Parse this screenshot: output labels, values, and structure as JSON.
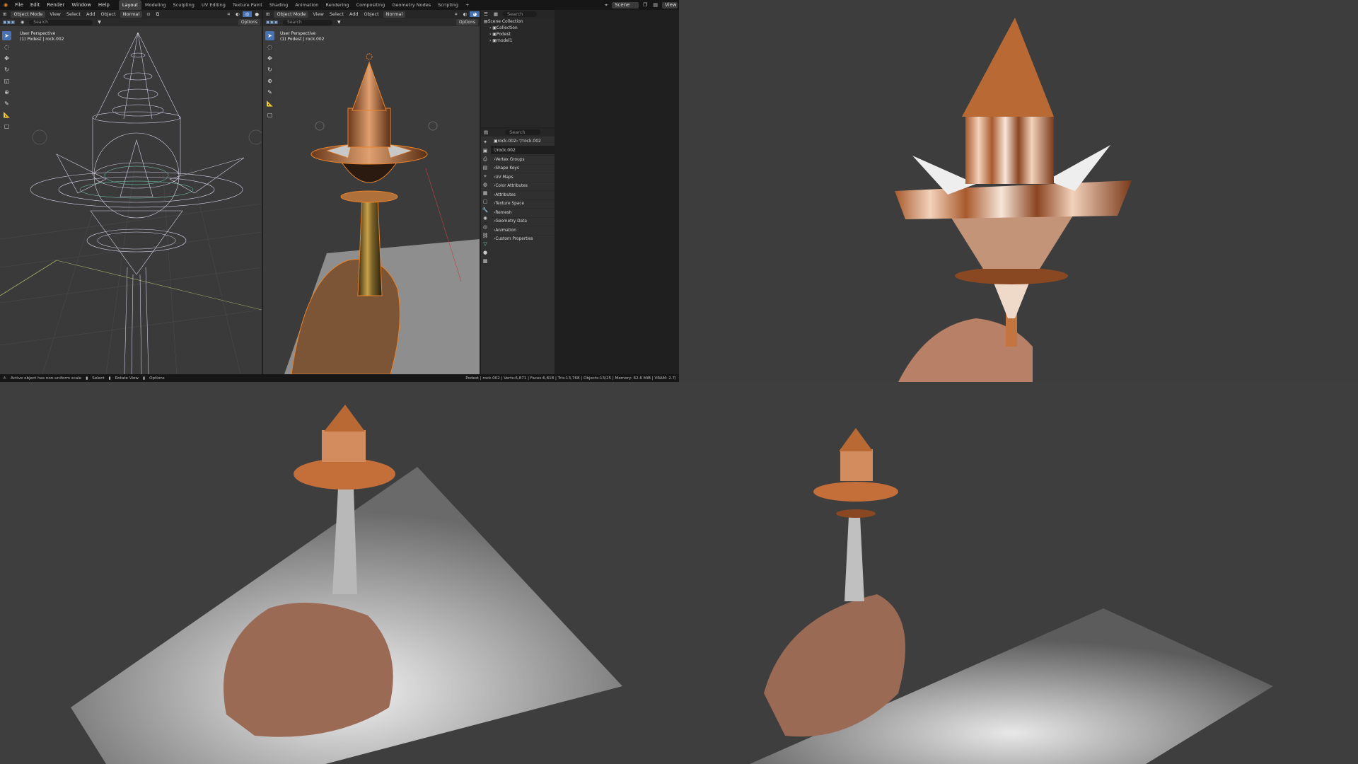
{
  "menu": [
    "File",
    "Edit",
    "Render",
    "Window",
    "Help"
  ],
  "workspaces": [
    {
      "label": "Layout",
      "active": true
    },
    {
      "label": "Modeling"
    },
    {
      "label": "Sculpting"
    },
    {
      "label": "UV Editing"
    },
    {
      "label": "Texture Paint"
    },
    {
      "label": "Shading"
    },
    {
      "label": "Animation"
    },
    {
      "label": "Rendering"
    },
    {
      "label": "Compositing"
    },
    {
      "label": "Geometry Nodes"
    },
    {
      "label": "Scripting"
    },
    {
      "label": "+"
    }
  ],
  "scene_label": "Scene",
  "view_label": "View",
  "viewport_left": {
    "mode": "Object Mode",
    "menus": [
      "View",
      "Select",
      "Add",
      "Object"
    ],
    "orientation": "Normal",
    "search_placeholder": "Search",
    "options": "Options",
    "overlay_line1": "User Perspective",
    "overlay_line2": "(1) Podest | rock.002"
  },
  "viewport_mid": {
    "mode": "Object Mode",
    "menus": [
      "View",
      "Select",
      "Add",
      "Object"
    ],
    "orientation": "Normal",
    "search_placeholder": "Search",
    "options": "Options",
    "overlay_line1": "User Perspective",
    "overlay_line2": "(1) Podest | rock.002"
  },
  "outliner": {
    "search_placeholder": "Search",
    "items": [
      {
        "label": "Scene Collection",
        "depth": 0
      },
      {
        "label": "Collection",
        "depth": 1
      },
      {
        "label": "Podest",
        "depth": 1
      },
      {
        "label": "model1",
        "depth": 1
      }
    ]
  },
  "properties": {
    "search_placeholder": "Search",
    "breadcrumb_object": "rock.002",
    "breadcrumb_mesh": "rock.002",
    "mesh_name": "rock.002",
    "panels": [
      "Vertex Groups",
      "Shape Keys",
      "UV Maps",
      "Color Attributes",
      "Attributes",
      "Texture Space",
      "Remesh",
      "Geometry Data",
      "Animation",
      "Custom Properties"
    ]
  },
  "status": {
    "warning": "Active object has non-uniform scale",
    "select": "Select",
    "rotate": "Rotate View",
    "options": "Options",
    "stats": "Podest | rock.002 | Verts:6,871 | Faces:6,818 | Tris:13,768 | Objects:13/25 | Memory: 62.6 MiB | VRAM: 2.7/"
  },
  "icons": {
    "tools": [
      "cursor-icon",
      "select-circle-icon",
      "move-icon",
      "rotate-icon",
      "scale-icon",
      "transform-icon",
      "annotate-icon",
      "measure-icon",
      "add-cube-icon"
    ],
    "property_tabs": [
      "tool-icon",
      "render-icon",
      "output-icon",
      "view-layer-icon",
      "scene-icon",
      "world-icon",
      "collection-icon",
      "object-icon",
      "modifier-icon",
      "particles-icon",
      "physics-icon",
      "constraints-icon",
      "data-icon",
      "material-icon",
      "texture-icon"
    ]
  },
  "colors": {
    "accent": "#4772b3",
    "copper": "#c87a4f",
    "selection": "#e8832b",
    "viewport_bg": "#3a3a3a",
    "panel_bg": "#303030"
  }
}
